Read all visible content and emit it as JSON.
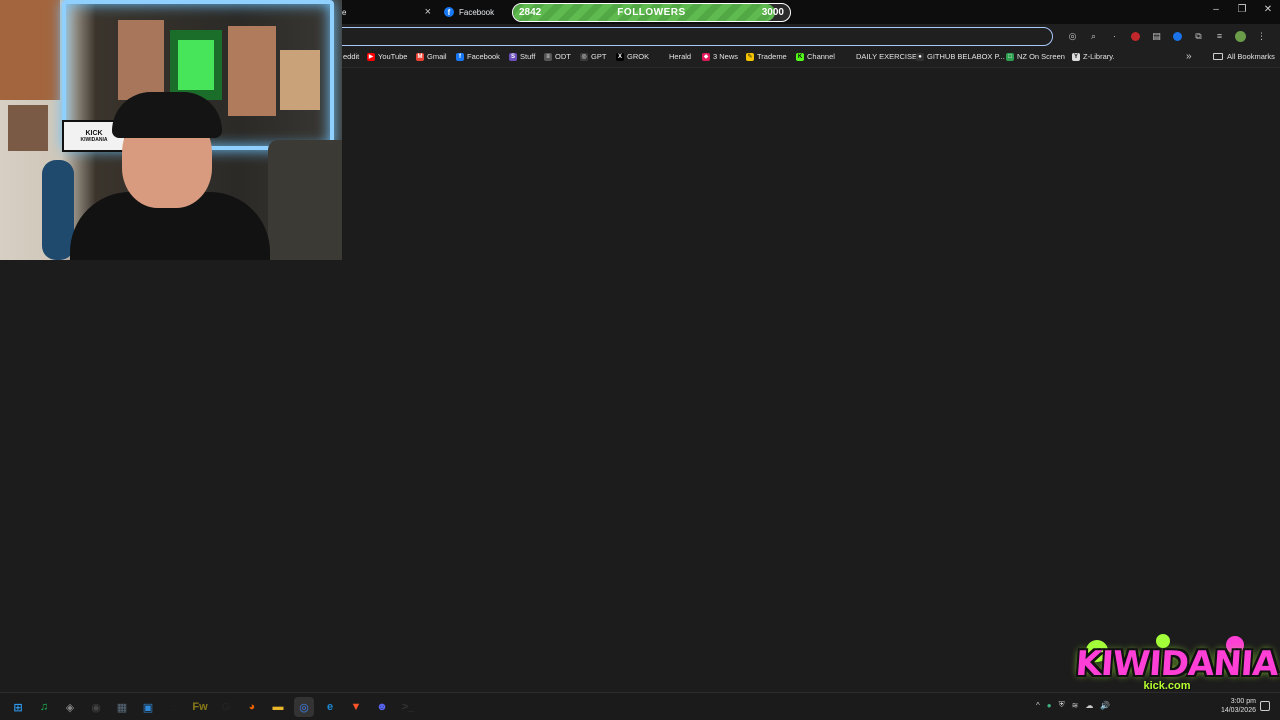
{
  "browser": {
    "tabs": [
      {
        "title": "e",
        "close": "×"
      },
      {
        "title": "Facebook"
      }
    ],
    "window_controls": [
      "–",
      "❐",
      "✕"
    ]
  },
  "followers_goal": {
    "current": "2842",
    "label": "FOLLOWERS",
    "goal": "3000",
    "progress": 0.947
  },
  "bookmarks": {
    "items": [
      {
        "label": "eddit",
        "icon": "reddit-icon",
        "color": "#ff4500",
        "glyph": ""
      },
      {
        "label": "YouTube",
        "icon": "youtube-icon",
        "color": "#ff0000",
        "glyph": "▶"
      },
      {
        "label": "Gmail",
        "icon": "gmail-icon",
        "color": "#ea4335",
        "glyph": "M"
      },
      {
        "label": "Facebook",
        "icon": "facebook-icon",
        "color": "#1877f2",
        "glyph": "f"
      },
      {
        "label": "Stuff",
        "icon": "stuff-icon",
        "color": "#6b4fbb",
        "glyph": "S"
      },
      {
        "label": "ODT",
        "icon": "odt-icon",
        "color": "#555555",
        "glyph": "≡"
      },
      {
        "label": "GPT",
        "icon": "chatgpt-icon",
        "color": "#3a3a3a",
        "glyph": "◎"
      },
      {
        "label": "GROK",
        "icon": "x-icon",
        "color": "#000000",
        "glyph": "X"
      },
      {
        "label": "Herald",
        "icon": "herald-icon",
        "color": "#1f1f1f",
        "glyph": ""
      },
      {
        "label": "3 News",
        "icon": "3news-icon",
        "color": "#e0195a",
        "glyph": "◆"
      },
      {
        "label": "Trademe",
        "icon": "trademe-icon",
        "color": "#f5c400",
        "glyph": "✎"
      },
      {
        "label": "Channel",
        "icon": "kick-icon",
        "color": "#53fc18",
        "glyph": "K"
      },
      {
        "label": "DAILY EXERCISE!",
        "icon": "blank-icon",
        "color": "#1f1f1f",
        "glyph": ""
      },
      {
        "label": "GITHUB BELABOX P...",
        "icon": "github-icon",
        "color": "#333333",
        "glyph": "●"
      },
      {
        "label": "NZ On Screen",
        "icon": "nzonscreen-icon",
        "color": "#2e9e4f",
        "glyph": "□"
      },
      {
        "label": "Z-Library.",
        "icon": "zlibrary-icon",
        "color": "#dddddd",
        "glyph": "Y"
      }
    ],
    "more": "»",
    "all_bookmarks": "All Bookmarks"
  },
  "webcam_board": {
    "line1": "KICK",
    "line2": "KIWIDANIA"
  },
  "logo": {
    "title": "KIWIDANIA",
    "subtitle": "kick.com"
  },
  "taskbar": {
    "apps": [
      {
        "name": "windows-start-icon",
        "color": "#2d9bf0",
        "glyph": "⊞"
      },
      {
        "name": "spotify-icon",
        "color": "#1db954",
        "glyph": "♫"
      },
      {
        "name": "shield-app-icon",
        "color": "#888888",
        "glyph": "◈"
      },
      {
        "name": "obs-icon",
        "color": "#444444",
        "glyph": "◉"
      },
      {
        "name": "desktop-app-icon",
        "color": "#5a6b7b",
        "glyph": "▦"
      },
      {
        "name": "blue-app-icon",
        "color": "#2f88d8",
        "glyph": "▣"
      },
      {
        "name": "steam-icon",
        "color": "#222222",
        "glyph": "♨"
      },
      {
        "name": "fireworks-icon",
        "color": "#8a7a18",
        "glyph": "Fw"
      },
      {
        "name": "gaming-app-icon",
        "color": "#222222",
        "glyph": "G"
      },
      {
        "name": "firefox-icon",
        "color": "#e66000",
        "glyph": "◕"
      },
      {
        "name": "file-explorer-icon",
        "color": "#e8b82a",
        "glyph": "▬"
      },
      {
        "name": "chrome-icon",
        "color": "#4285f4",
        "glyph": "◎"
      },
      {
        "name": "edge-icon",
        "color": "#1c8ad8",
        "glyph": "e"
      },
      {
        "name": "brave-icon",
        "color": "#fb542b",
        "glyph": "▼"
      },
      {
        "name": "discord-icon",
        "color": "#5865f2",
        "glyph": "☻"
      },
      {
        "name": "terminal-icon",
        "color": "#333333",
        "glyph": ">_"
      }
    ],
    "active_app": 11,
    "tray": [
      "^",
      "●",
      "⛨",
      "≋",
      "☁",
      "🔊"
    ],
    "time": "3:00 pm",
    "date": "14/03/2026"
  },
  "colors": {
    "accent": "#a8c7fa",
    "followers_bar": "#5fbb4f",
    "logo_pink": "#ff3fd6",
    "logo_green": "#b6ff2e"
  }
}
